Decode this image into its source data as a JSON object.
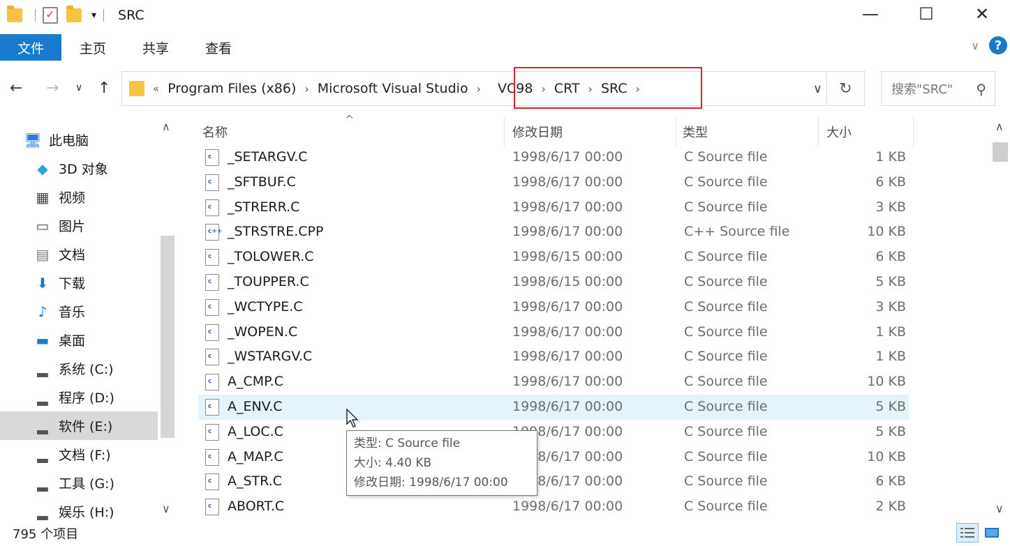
{
  "window": {
    "title": "SRC",
    "minimize_glyph": "—",
    "maximize_glyph": "☐",
    "close_glyph": "✕"
  },
  "ribbon": {
    "file_tab": "文件",
    "tabs": [
      "主页",
      "共享",
      "查看"
    ]
  },
  "address": {
    "lead": "«",
    "crumbs": [
      "Program Files (x86)",
      "Microsoft Visual Studio",
      "VC98",
      "CRT",
      "SRC"
    ],
    "search_placeholder": "搜索\"SRC\""
  },
  "sidebar": {
    "items": [
      {
        "label": "此电脑",
        "icon": "computer-icon"
      },
      {
        "label": "3D 对象",
        "icon": "3d-objects-icon"
      },
      {
        "label": "视频",
        "icon": "video-icon"
      },
      {
        "label": "图片",
        "icon": "pictures-icon"
      },
      {
        "label": "文档",
        "icon": "documents-icon"
      },
      {
        "label": "下载",
        "icon": "download-icon"
      },
      {
        "label": "音乐",
        "icon": "music-icon"
      },
      {
        "label": "桌面",
        "icon": "desktop-icon"
      },
      {
        "label": "系统 (C:)",
        "icon": "system-drive-icon"
      },
      {
        "label": "程序 (D:)",
        "icon": "drive-icon"
      },
      {
        "label": "软件 (E:)",
        "icon": "drive-icon",
        "selected": true
      },
      {
        "label": "文档 (F:)",
        "icon": "drive-icon"
      },
      {
        "label": "工具 (G:)",
        "icon": "drive-icon"
      },
      {
        "label": "娱乐 (H:)",
        "icon": "drive-icon"
      }
    ]
  },
  "columns": {
    "name": "名称",
    "date": "修改日期",
    "type": "类型",
    "size": "大小"
  },
  "files": [
    {
      "name": "_SETARGV.C",
      "date": "1998/6/17 00:00",
      "type": "C Source file",
      "size": "1 KB",
      "icon": "c"
    },
    {
      "name": "_SFTBUF.C",
      "date": "1998/6/17 00:00",
      "type": "C Source file",
      "size": "6 KB",
      "icon": "c"
    },
    {
      "name": "_STRERR.C",
      "date": "1998/6/17 00:00",
      "type": "C Source file",
      "size": "3 KB",
      "icon": "c"
    },
    {
      "name": "_STRSTRE.CPP",
      "date": "1998/6/17 00:00",
      "type": "C++ Source file",
      "size": "10 KB",
      "icon": "c++"
    },
    {
      "name": "_TOLOWER.C",
      "date": "1998/6/15 00:00",
      "type": "C Source file",
      "size": "6 KB",
      "icon": "c"
    },
    {
      "name": "_TOUPPER.C",
      "date": "1998/6/15 00:00",
      "type": "C Source file",
      "size": "5 KB",
      "icon": "c"
    },
    {
      "name": "_WCTYPE.C",
      "date": "1998/6/17 00:00",
      "type": "C Source file",
      "size": "3 KB",
      "icon": "c"
    },
    {
      "name": "_WOPEN.C",
      "date": "1998/6/17 00:00",
      "type": "C Source file",
      "size": "1 KB",
      "icon": "c"
    },
    {
      "name": "_WSTARGV.C",
      "date": "1998/6/17 00:00",
      "type": "C Source file",
      "size": "1 KB",
      "icon": "c"
    },
    {
      "name": "A_CMP.C",
      "date": "1998/6/17 00:00",
      "type": "C Source file",
      "size": "10 KB",
      "icon": "c"
    },
    {
      "name": "A_ENV.C",
      "date": "1998/6/17 00:00",
      "type": "C Source file",
      "size": "5 KB",
      "icon": "c",
      "hover": true
    },
    {
      "name": "A_LOC.C",
      "date": "1998/6/17 00:00",
      "type": "C Source file",
      "size": "5 KB",
      "icon": "c"
    },
    {
      "name": "A_MAP.C",
      "date": "1998/6/17 00:00",
      "type": "C Source file",
      "size": "10 KB",
      "icon": "c"
    },
    {
      "name": "A_STR.C",
      "date": "1998/6/17 00:00",
      "type": "C Source file",
      "size": "6 KB",
      "icon": "c"
    },
    {
      "name": "ABORT.C",
      "date": "1998/6/17 00:00",
      "type": "C Source file",
      "size": "2 KB",
      "icon": "c"
    }
  ],
  "tooltip": {
    "type_line": "类型: C Source file",
    "size_line": "大小: 4.40 KB",
    "date_line": "修改日期: 1998/6/17 00:00"
  },
  "status": {
    "item_count": "795 个项目"
  },
  "colors": {
    "accent": "#1979ca",
    "highlight_border": "#e02020",
    "hover_row": "#e5f3fb"
  }
}
